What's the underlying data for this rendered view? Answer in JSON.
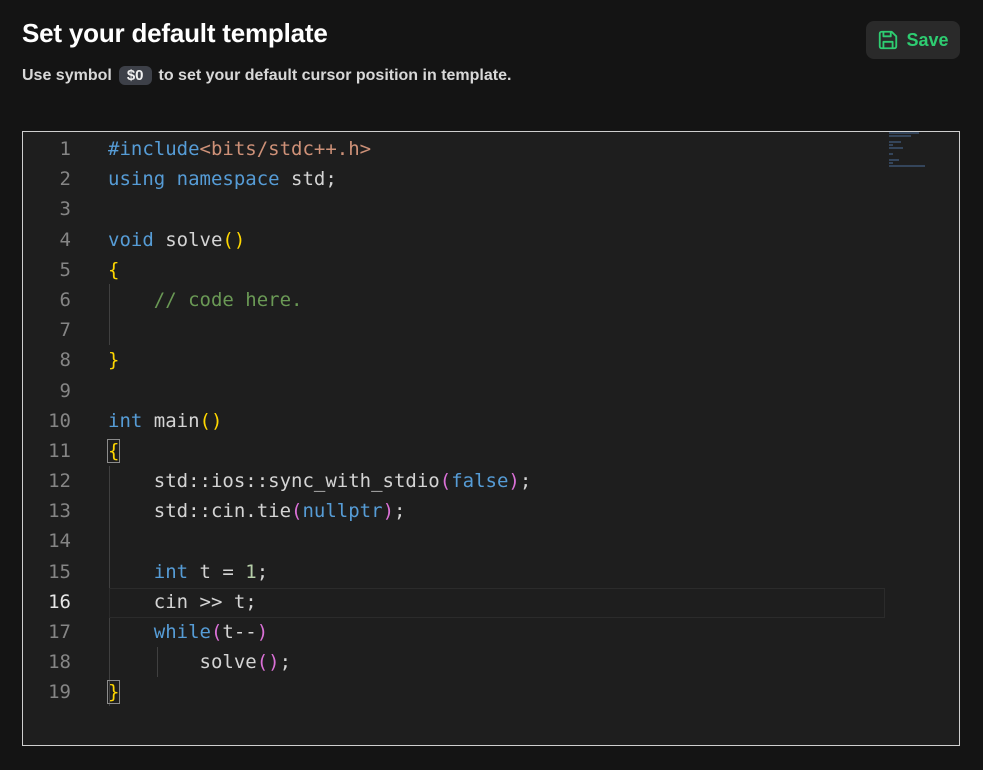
{
  "header": {
    "title": "Set your default template",
    "subtitle_before": "Use symbol",
    "subtitle_symbol": "$0",
    "subtitle_after": "to set your default cursor position in template.",
    "save_label": "Save"
  },
  "editor": {
    "active_line": 16,
    "lines": [
      {
        "n": "1",
        "tokens": [
          [
            "pp",
            "#include"
          ],
          [
            "str",
            "<bits/stdc++.h>"
          ]
        ]
      },
      {
        "n": "2",
        "tokens": [
          [
            "kw",
            "using"
          ],
          [
            "",
            " "
          ],
          [
            "kw",
            "namespace"
          ],
          [
            "",
            " std;"
          ]
        ]
      },
      {
        "n": "3",
        "tokens": []
      },
      {
        "n": "4",
        "tokens": [
          [
            "kw",
            "void"
          ],
          [
            "",
            " solve"
          ],
          [
            "br1",
            "()"
          ]
        ]
      },
      {
        "n": "5",
        "tokens": [
          [
            "br1",
            "{"
          ]
        ]
      },
      {
        "n": "6",
        "tokens": [
          [
            "",
            "    "
          ],
          [
            "cm",
            "// code here."
          ]
        ]
      },
      {
        "n": "7",
        "tokens": []
      },
      {
        "n": "8",
        "tokens": [
          [
            "br1",
            "}"
          ]
        ]
      },
      {
        "n": "9",
        "tokens": []
      },
      {
        "n": "10",
        "tokens": [
          [
            "kw",
            "int"
          ],
          [
            "",
            " main"
          ],
          [
            "br1",
            "()"
          ]
        ]
      },
      {
        "n": "11",
        "tokens": [
          [
            "br1 hl",
            "{"
          ]
        ]
      },
      {
        "n": "12",
        "tokens": [
          [
            "",
            "    std::ios::sync_with_stdio"
          ],
          [
            "br2",
            "("
          ],
          [
            "kw",
            "false"
          ],
          [
            "br2",
            ")"
          ],
          [
            "",
            ";"
          ]
        ]
      },
      {
        "n": "13",
        "tokens": [
          [
            "",
            "    std::cin.tie"
          ],
          [
            "br2",
            "("
          ],
          [
            "kw",
            "nullptr"
          ],
          [
            "br2",
            ")"
          ],
          [
            "",
            ";"
          ]
        ]
      },
      {
        "n": "14",
        "tokens": []
      },
      {
        "n": "15",
        "tokens": [
          [
            "",
            "    "
          ],
          [
            "kw",
            "int"
          ],
          [
            "",
            " t = "
          ],
          [
            "num",
            "1"
          ],
          [
            "",
            ";"
          ]
        ]
      },
      {
        "n": "16",
        "tokens": [
          [
            "",
            "    cin >> t;"
          ]
        ]
      },
      {
        "n": "17",
        "tokens": [
          [
            "",
            "    "
          ],
          [
            "kw",
            "while"
          ],
          [
            "br2",
            "("
          ],
          [
            "",
            "t--"
          ],
          [
            "br2",
            ")"
          ]
        ]
      },
      {
        "n": "18",
        "tokens": [
          [
            "",
            "        solve"
          ],
          [
            "br2",
            "()"
          ],
          [
            "",
            ";"
          ]
        ]
      },
      {
        "n": "19",
        "tokens": [
          [
            "br1 hl",
            "}"
          ]
        ]
      }
    ]
  }
}
